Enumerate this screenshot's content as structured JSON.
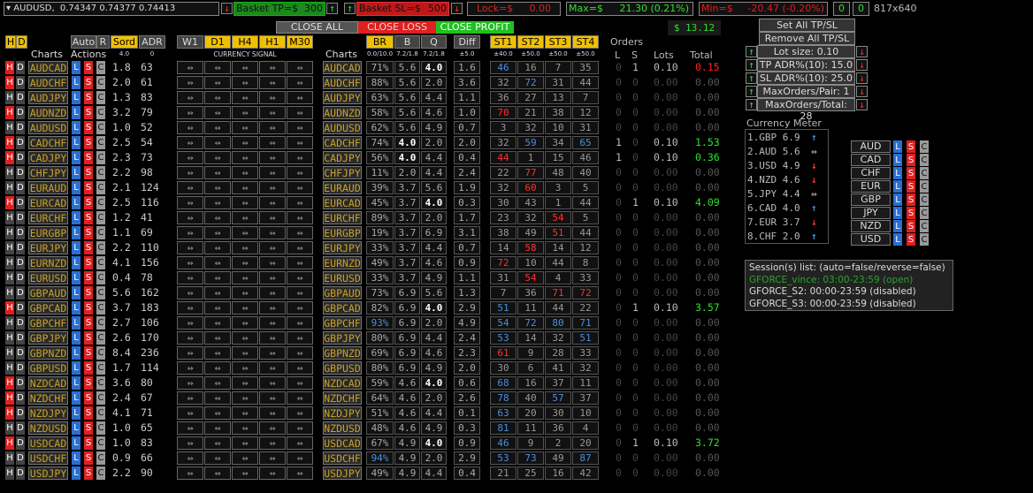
{
  "toolbar": {
    "symbol": "AUDUSD,",
    "quote": "0.74347 0.74377 0.74413",
    "basket_tp_label": "Basket TP=$",
    "basket_tp_value": "300",
    "basket_sl_label": "Basket SL=$",
    "basket_sl_value": "500",
    "lock_label": "Lock=$",
    "lock_value": "0.00",
    "max_label": "Max=$",
    "max_value": "21.30 (0.21%)",
    "min_label": "Min=$",
    "min_value": "-20.47 (-0.20%)",
    "counter_a": "0",
    "counter_b": "0",
    "resolution": "817x640",
    "up_arrow": "↑",
    "down_arrow": "↓"
  },
  "actions": {
    "close_all": "CLOSE ALL",
    "close_loss": "CLOSE LOSS",
    "close_profit": "CLOSE PROFIT",
    "total_pl": "$  13.12"
  },
  "headers": {
    "h": "H",
    "d": "D",
    "auto": "Auto",
    "r": "R",
    "sord": "Sord",
    "adr": "ADR",
    "charts": "Charts",
    "actions": "Actions",
    "sord_sub": "4.0",
    "adr_sub": "0",
    "w1": "W1",
    "d1": "D1",
    "h4": "H4",
    "h1": "H1",
    "m30": "M30",
    "currency_signal": "CURRENCY SIGNAL",
    "br": "BR",
    "b": "B",
    "q": "Q",
    "diff": "Diff",
    "br_sub": "0.0/10.0",
    "b_sub": "7.2/1.8",
    "q_sub": "7.2/1.8",
    "diff_sub": "±5.0",
    "st1": "ST1",
    "st2": "ST2",
    "st3": "ST3",
    "st4": "ST4",
    "st1_sub": "±40.0",
    "st2_sub": "±50.0",
    "st3_sub": "±50.0",
    "st4_sub": "±50.0",
    "orders": "Orders",
    "l": "L",
    "s": "S",
    "lots": "Lots",
    "total": "Total",
    "btn_l": "L",
    "btn_s": "S",
    "btn_c": "C",
    "signal_glyph": "⇔"
  },
  "rows": [
    {
      "sym": "AUDCAD",
      "sord": "1.8",
      "adr": "63",
      "br": "71%",
      "b": "5.6",
      "q": "4.0",
      "diff": "1.6",
      "st": [
        "46",
        "16",
        "7",
        "35"
      ],
      "st_colors": [
        "#4a8fe0",
        "#999",
        "#999",
        "#999"
      ],
      "l": "0",
      "s": "1",
      "lots": "0.10",
      "total": "0.15",
      "tc": "#ff2020",
      "hred": true,
      "b_bold": false,
      "q_bold": true
    },
    {
      "sym": "AUDCHF",
      "sord": "2.0",
      "adr": "61",
      "br": "88%",
      "b": "5.6",
      "q": "2.0",
      "diff": "3.6",
      "st": [
        "32",
        "72",
        "31",
        "44"
      ],
      "st_colors": [
        "#999",
        "#4a8fe0",
        "#999",
        "#999"
      ],
      "l": "0",
      "s": "0",
      "lots": "0.00",
      "total": "0.00",
      "tc": "#555",
      "hred": true,
      "b_bold": false,
      "q_bold": false
    },
    {
      "sym": "AUDJPY",
      "sord": "1.3",
      "adr": "83",
      "br": "63%",
      "b": "5.6",
      "q": "4.4",
      "diff": "1.1",
      "st": [
        "36",
        "27",
        "13",
        "7"
      ],
      "st_colors": [
        "#999",
        "#999",
        "#999",
        "#999"
      ],
      "l": "0",
      "s": "0",
      "lots": "0.00",
      "total": "0.00",
      "tc": "#555",
      "hred": false,
      "b_bold": false,
      "q_bold": false
    },
    {
      "sym": "AUDNZD",
      "sord": "3.2",
      "adr": "79",
      "br": "58%",
      "b": "5.6",
      "q": "4.6",
      "diff": "1.0",
      "st": [
        "70",
        "21",
        "38",
        "12"
      ],
      "st_colors": [
        "#ff3030",
        "#999",
        "#999",
        "#999"
      ],
      "l": "0",
      "s": "0",
      "lots": "0.00",
      "total": "0.00",
      "tc": "#555",
      "hred": true,
      "b_bold": false,
      "q_bold": false
    },
    {
      "sym": "AUDUSD",
      "sord": "1.0",
      "adr": "52",
      "br": "62%",
      "b": "5.6",
      "q": "4.9",
      "diff": "0.7",
      "st": [
        "3",
        "32",
        "10",
        "31"
      ],
      "st_colors": [
        "#999",
        "#999",
        "#999",
        "#999"
      ],
      "l": "0",
      "s": "0",
      "lots": "0.00",
      "total": "0.00",
      "tc": "#555",
      "hred": false,
      "b_bold": false,
      "q_bold": false
    },
    {
      "sym": "CADCHF",
      "sord": "2.5",
      "adr": "54",
      "br": "74%",
      "b": "4.0",
      "q": "2.0",
      "diff": "2.0",
      "st": [
        "32",
        "59",
        "34",
        "65"
      ],
      "st_colors": [
        "#999",
        "#4a8fe0",
        "#999",
        "#4a8fe0"
      ],
      "l": "1",
      "s": "0",
      "lots": "0.10",
      "total": "1.53",
      "tc": "#30e030",
      "hred": true,
      "b_bold": true,
      "q_bold": false
    },
    {
      "sym": "CADJPY",
      "sord": "2.3",
      "adr": "73",
      "br": "56%",
      "b": "4.0",
      "q": "4.4",
      "diff": "0.4",
      "st": [
        "44",
        "1",
        "15",
        "46"
      ],
      "st_colors": [
        "#ff3030",
        "#999",
        "#999",
        "#999"
      ],
      "l": "1",
      "s": "0",
      "lots": "0.10",
      "total": "0.36",
      "tc": "#30e030",
      "hred": true,
      "b_bold": true,
      "q_bold": false
    },
    {
      "sym": "CHFJPY",
      "sord": "2.2",
      "adr": "98",
      "br": "11%",
      "b": "2.0",
      "q": "4.4",
      "diff": "2.4",
      "st": [
        "22",
        "77",
        "48",
        "40"
      ],
      "st_colors": [
        "#999",
        "#ff3030",
        "#999",
        "#999"
      ],
      "l": "0",
      "s": "0",
      "lots": "0.00",
      "total": "0.00",
      "tc": "#555",
      "hred": false,
      "b_bold": false,
      "q_bold": false
    },
    {
      "sym": "EURAUD",
      "sord": "2.1",
      "adr": "124",
      "br": "39%",
      "b": "3.7",
      "q": "5.6",
      "diff": "1.9",
      "st": [
        "32",
        "60",
        "3",
        "5"
      ],
      "st_colors": [
        "#999",
        "#ff3030",
        "#999",
        "#999"
      ],
      "l": "0",
      "s": "0",
      "lots": "0.00",
      "total": "0.00",
      "tc": "#555",
      "hred": false,
      "b_bold": false,
      "q_bold": false
    },
    {
      "sym": "EURCAD",
      "sord": "2.5",
      "adr": "116",
      "br": "45%",
      "b": "3.7",
      "q": "4.0",
      "diff": "0.3",
      "st": [
        "30",
        "43",
        "1",
        "44"
      ],
      "st_colors": [
        "#999",
        "#999",
        "#999",
        "#999"
      ],
      "l": "0",
      "s": "1",
      "lots": "0.10",
      "total": "4.09",
      "tc": "#30e030",
      "hred": true,
      "b_bold": false,
      "q_bold": true
    },
    {
      "sym": "EURCHF",
      "sord": "1.2",
      "adr": "41",
      "br": "89%",
      "b": "3.7",
      "q": "2.0",
      "diff": "1.7",
      "st": [
        "23",
        "32",
        "54",
        "5"
      ],
      "st_colors": [
        "#999",
        "#999",
        "#ff3030",
        "#999"
      ],
      "l": "0",
      "s": "0",
      "lots": "0.00",
      "total": "0.00",
      "tc": "#555",
      "hred": false,
      "b_bold": false,
      "q_bold": false
    },
    {
      "sym": "EURGBP",
      "sord": "1.1",
      "adr": "69",
      "br": "19%",
      "b": "3.7",
      "q": "6.9",
      "diff": "3.1",
      "st": [
        "38",
        "49",
        "51",
        "44"
      ],
      "st_colors": [
        "#999",
        "#999",
        "#ff3030",
        "#999"
      ],
      "l": "0",
      "s": "0",
      "lots": "0.00",
      "total": "0.00",
      "tc": "#555",
      "hred": false,
      "b_bold": false,
      "q_bold": false
    },
    {
      "sym": "EURJPY",
      "sord": "2.2",
      "adr": "110",
      "br": "33%",
      "b": "3.7",
      "q": "4.4",
      "diff": "0.7",
      "st": [
        "14",
        "58",
        "14",
        "12"
      ],
      "st_colors": [
        "#999",
        "#ff3030",
        "#999",
        "#999"
      ],
      "l": "0",
      "s": "0",
      "lots": "0.00",
      "total": "0.00",
      "tc": "#555",
      "hred": false,
      "b_bold": false,
      "q_bold": false
    },
    {
      "sym": "EURNZD",
      "sord": "4.1",
      "adr": "156",
      "br": "49%",
      "b": "3.7",
      "q": "4.6",
      "diff": "0.9",
      "st": [
        "72",
        "10",
        "44",
        "8"
      ],
      "st_colors": [
        "#ff3030",
        "#999",
        "#999",
        "#999"
      ],
      "l": "0",
      "s": "0",
      "lots": "0.00",
      "total": "0.00",
      "tc": "#555",
      "hred": false,
      "b_bold": false,
      "q_bold": false
    },
    {
      "sym": "EURUSD",
      "sord": "0.4",
      "adr": "78",
      "br": "33%",
      "b": "3.7",
      "q": "4.9",
      "diff": "1.1",
      "st": [
        "31",
        "54",
        "4",
        "33"
      ],
      "st_colors": [
        "#999",
        "#ff3030",
        "#999",
        "#999"
      ],
      "l": "0",
      "s": "0",
      "lots": "0.00",
      "total": "0.00",
      "tc": "#555",
      "hred": false,
      "b_bold": false,
      "q_bold": false
    },
    {
      "sym": "GBPAUD",
      "sord": "5.6",
      "adr": "162",
      "br": "73%",
      "b": "6.9",
      "q": "5.6",
      "diff": "1.3",
      "st": [
        "7",
        "36",
        "71",
        "72"
      ],
      "st_colors": [
        "#999",
        "#999",
        "#ff3030",
        "#ff3030"
      ],
      "l": "0",
      "s": "0",
      "lots": "0.00",
      "total": "0.00",
      "tc": "#555",
      "hred": false,
      "b_bold": false,
      "q_bold": false
    },
    {
      "sym": "GBPCAD",
      "sord": "3.7",
      "adr": "183",
      "br": "82%",
      "b": "6.9",
      "q": "4.0",
      "diff": "2.9",
      "st": [
        "51",
        "11",
        "44",
        "22"
      ],
      "st_colors": [
        "#4a8fe0",
        "#999",
        "#999",
        "#999"
      ],
      "l": "0",
      "s": "1",
      "lots": "0.10",
      "total": "3.57",
      "tc": "#30e030",
      "hred": true,
      "b_bold": false,
      "q_bold": true
    },
    {
      "sym": "GBPCHF",
      "sord": "2.7",
      "adr": "106",
      "br": "93%",
      "b": "6.9",
      "q": "2.0",
      "diff": "4.9",
      "st": [
        "54",
        "72",
        "80",
        "71"
      ],
      "st_colors": [
        "#4a8fe0",
        "#4a8fe0",
        "#4a8fe0",
        "#4a8fe0"
      ],
      "l": "0",
      "s": "0",
      "lots": "0.00",
      "total": "0.00",
      "tc": "#555",
      "hred": false,
      "b_bold": false,
      "q_bold": false,
      "br_blue": true
    },
    {
      "sym": "GBPJPY",
      "sord": "2.6",
      "adr": "170",
      "br": "80%",
      "b": "6.9",
      "q": "4.4",
      "diff": "2.4",
      "st": [
        "53",
        "14",
        "32",
        "51"
      ],
      "st_colors": [
        "#4a8fe0",
        "#999",
        "#999",
        "#4a8fe0"
      ],
      "l": "0",
      "s": "0",
      "lots": "0.00",
      "total": "0.00",
      "tc": "#555",
      "hred": false,
      "b_bold": false,
      "q_bold": false
    },
    {
      "sym": "GBPNZD",
      "sord": "8.4",
      "adr": "236",
      "br": "69%",
      "b": "6.9",
      "q": "4.6",
      "diff": "2.3",
      "st": [
        "61",
        "9",
        "28",
        "33"
      ],
      "st_colors": [
        "#ff3030",
        "#999",
        "#999",
        "#999"
      ],
      "l": "0",
      "s": "0",
      "lots": "0.00",
      "total": "0.00",
      "tc": "#555",
      "hred": false,
      "b_bold": false,
      "q_bold": false
    },
    {
      "sym": "GBPUSD",
      "sord": "1.7",
      "adr": "114",
      "br": "80%",
      "b": "6.9",
      "q": "4.9",
      "diff": "2.0",
      "st": [
        "30",
        "6",
        "41",
        "32"
      ],
      "st_colors": [
        "#999",
        "#999",
        "#999",
        "#999"
      ],
      "l": "0",
      "s": "0",
      "lots": "0.00",
      "total": "0.00",
      "tc": "#555",
      "hred": false,
      "b_bold": false,
      "q_bold": false
    },
    {
      "sym": "NZDCAD",
      "sord": "3.6",
      "adr": "80",
      "br": "59%",
      "b": "4.6",
      "q": "4.0",
      "diff": "0.6",
      "st": [
        "68",
        "16",
        "37",
        "11"
      ],
      "st_colors": [
        "#4a8fe0",
        "#999",
        "#999",
        "#999"
      ],
      "l": "0",
      "s": "0",
      "lots": "0.00",
      "total": "0.00",
      "tc": "#555",
      "hred": true,
      "b_bold": false,
      "q_bold": true
    },
    {
      "sym": "NZDCHF",
      "sord": "2.4",
      "adr": "67",
      "br": "64%",
      "b": "4.6",
      "q": "2.0",
      "diff": "2.6",
      "st": [
        "78",
        "40",
        "57",
        "37"
      ],
      "st_colors": [
        "#4a8fe0",
        "#999",
        "#4a8fe0",
        "#999"
      ],
      "l": "0",
      "s": "0",
      "lots": "0.00",
      "total": "0.00",
      "tc": "#555",
      "hred": true,
      "b_bold": false,
      "q_bold": false
    },
    {
      "sym": "NZDJPY",
      "sord": "4.1",
      "adr": "71",
      "br": "51%",
      "b": "4.6",
      "q": "4.4",
      "diff": "0.1",
      "st": [
        "63",
        "20",
        "30",
        "10"
      ],
      "st_colors": [
        "#4a8fe0",
        "#999",
        "#999",
        "#999"
      ],
      "l": "0",
      "s": "0",
      "lots": "0.00",
      "total": "0.00",
      "tc": "#555",
      "hred": true,
      "b_bold": false,
      "q_bold": false
    },
    {
      "sym": "NZDUSD",
      "sord": "1.0",
      "adr": "65",
      "br": "48%",
      "b": "4.6",
      "q": "4.9",
      "diff": "0.3",
      "st": [
        "81",
        "11",
        "36",
        "4"
      ],
      "st_colors": [
        "#4a8fe0",
        "#999",
        "#999",
        "#999"
      ],
      "l": "0",
      "s": "0",
      "lots": "0.00",
      "total": "0.00",
      "tc": "#555",
      "hred": false,
      "b_bold": false,
      "q_bold": false
    },
    {
      "sym": "USDCAD",
      "sord": "1.0",
      "adr": "83",
      "br": "67%",
      "b": "4.9",
      "q": "4.0",
      "diff": "0.9",
      "st": [
        "46",
        "9",
        "2",
        "20"
      ],
      "st_colors": [
        "#4a8fe0",
        "#999",
        "#999",
        "#999"
      ],
      "l": "0",
      "s": "1",
      "lots": "0.10",
      "total": "3.72",
      "tc": "#30e030",
      "hred": true,
      "b_bold": false,
      "q_bold": true
    },
    {
      "sym": "USDCHF",
      "sord": "0.9",
      "adr": "66",
      "br": "94%",
      "b": "4.9",
      "q": "2.0",
      "diff": "2.9",
      "st": [
        "53",
        "73",
        "49",
        "87"
      ],
      "st_colors": [
        "#4a8fe0",
        "#4a8fe0",
        "#999",
        "#4a8fe0"
      ],
      "l": "0",
      "s": "0",
      "lots": "0.00",
      "total": "0.00",
      "tc": "#555",
      "hred": false,
      "b_bold": false,
      "q_bold": false,
      "br_blue": true
    },
    {
      "sym": "USDJPY",
      "sord": "2.2",
      "adr": "90",
      "br": "49%",
      "b": "4.9",
      "q": "4.4",
      "diff": "0.4",
      "st": [
        "21",
        "25",
        "16",
        "42"
      ],
      "st_colors": [
        "#999",
        "#999",
        "#999",
        "#999"
      ],
      "l": "0",
      "s": "0",
      "lots": "0.00",
      "total": "0.00",
      "tc": "#555",
      "hred": false,
      "b_bold": false,
      "q_bold": false
    }
  ],
  "right_panel": {
    "set_all": "Set All TP/SL",
    "remove_all": "Remove All TP/SL",
    "lot_size": "Lot size: 0.10",
    "tp_adr": "TP ADR%(10): 15.0",
    "sl_adr": "SL ADR%(10): 25.0",
    "max_orders_pair": "MaxOrders/Pair: 1",
    "max_orders_total": "MaxOrders/Total: 28",
    "currency_meter_title": "Currency Meter",
    "meter": [
      {
        "label": "1.GBP 6.9",
        "dir": "↑",
        "color": "#4a8fe0"
      },
      {
        "label": "2.AUD 5.6",
        "dir": "⇔",
        "color": "#aaa"
      },
      {
        "label": "3.USD 4.9",
        "dir": "↓",
        "color": "#ff3030"
      },
      {
        "label": "4.NZD 4.6",
        "dir": "↓",
        "color": "#ff3030"
      },
      {
        "label": "5.JPY 4.4",
        "dir": "⇔",
        "color": "#aaa"
      },
      {
        "label": "6.CAD 4.0",
        "dir": "↑",
        "color": "#4a8fe0"
      },
      {
        "label": "7.EUR 3.7",
        "dir": "↓",
        "color": "#ff3030"
      },
      {
        "label": "8.CHF 2.0",
        "dir": "↑",
        "color": "#4a8fe0"
      }
    ],
    "currencies": [
      "AUD",
      "CAD",
      "CHF",
      "EUR",
      "GBP",
      "JPY",
      "NZD",
      "USD"
    ],
    "sessions_title": "Session(s) list: (auto=false/reverse=false)",
    "sessions": [
      {
        "text": "GFORCE_vince: 03:00-23:59 (open)",
        "color": "#30a030"
      },
      {
        "text": "GFORCE_S2: 00:00-23:59 (disabled)",
        "color": "#ddd"
      },
      {
        "text": "GFORCE_S3: 00:00-23:59 (disabled)",
        "color": "#ddd"
      }
    ]
  },
  "colors": {
    "yellow": "#f0c000",
    "red": "#e02020",
    "green": "#20c020",
    "blue": "#4a8fe0"
  }
}
